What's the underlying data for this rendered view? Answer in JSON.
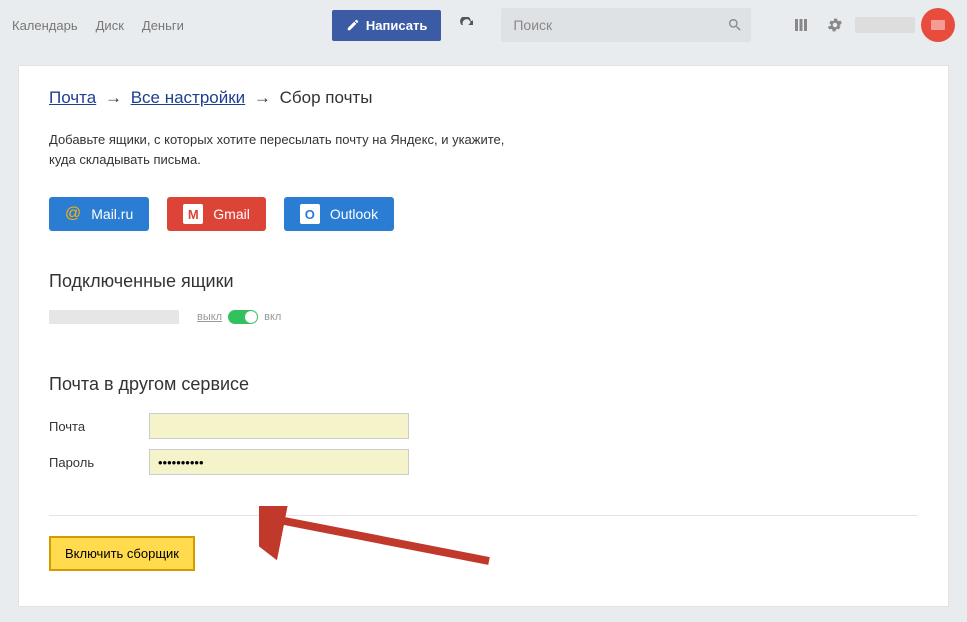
{
  "topnav": {
    "calendar": "Календарь",
    "disk": "Диск",
    "money": "Деньги"
  },
  "compose_label": "Написать",
  "search": {
    "placeholder": "Поиск"
  },
  "breadcrumb": {
    "mail": "Почта",
    "all_settings": "Все настройки",
    "current": "Сбор почты"
  },
  "description": "Добавьте ящики, с которых хотите пересылать почту на Яндекс, и укажите, куда складывать письма.",
  "providers": {
    "mailru": "Mail.ru",
    "gmail": "Gmail",
    "outlook": "Outlook"
  },
  "connected": {
    "heading": "Подключенные ящики",
    "off_label": "выкл",
    "on_label": "вкл"
  },
  "other_service": {
    "heading": "Почта в другом сервисе",
    "email_label": "Почта",
    "password_label": "Пароль",
    "password_value": "••••••••••"
  },
  "submit_label": "Включить сборщик"
}
